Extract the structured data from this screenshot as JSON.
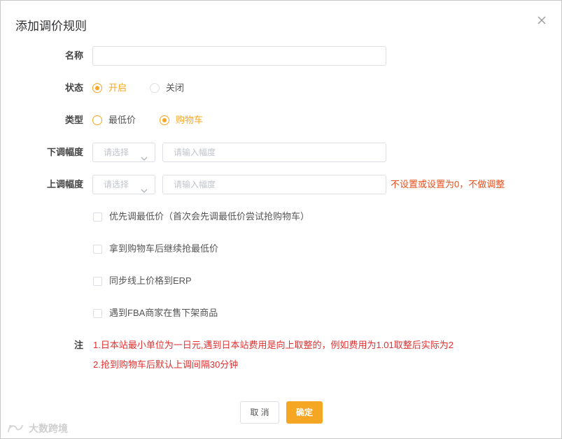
{
  "dialog": {
    "title": "添加调价规则"
  },
  "form": {
    "name": {
      "label": "名称",
      "value": "",
      "placeholder": ""
    },
    "status": {
      "label": "状态",
      "options": [
        "开启",
        "关闭"
      ],
      "selected": "开启"
    },
    "type": {
      "label": "类型",
      "options": [
        "最低价",
        "购物车"
      ],
      "selected": "购物车"
    },
    "down_range": {
      "label": "下调幅度",
      "select_placeholder": "请选择",
      "input_placeholder": "请输入幅度"
    },
    "up_range": {
      "label": "上调幅度",
      "select_placeholder": "请选择",
      "input_placeholder": "请输入幅度",
      "hint": "不设置或设置为0，不做调整"
    },
    "checkboxes": [
      {
        "label": "优先调最低价（首次会先调最低价尝试抢购物车）",
        "checked": false
      },
      {
        "label": "拿到购物车后继续抢最低价",
        "checked": false
      },
      {
        "label": "同步线上价格到ERP",
        "checked": false
      },
      {
        "label": "遇到FBA商家在售下架商品",
        "checked": false
      }
    ],
    "note": {
      "label": "注",
      "lines": [
        "1.日本站最小单位为一日元,遇到日本站费用是向上取整的，例如费用为1.01取整后实际为2",
        "2.抢到购物车后默认上调间隔30分钟"
      ]
    }
  },
  "footer": {
    "cancel_label": "取 消",
    "confirm_label": "确定"
  },
  "watermark": {
    "text": "大数跨境"
  },
  "colors": {
    "accent": "#f5a623",
    "hint": "#e8501f",
    "note": "#e03030"
  },
  "icons": {
    "close": "close-icon",
    "chevron": "chevron-down-icon"
  }
}
